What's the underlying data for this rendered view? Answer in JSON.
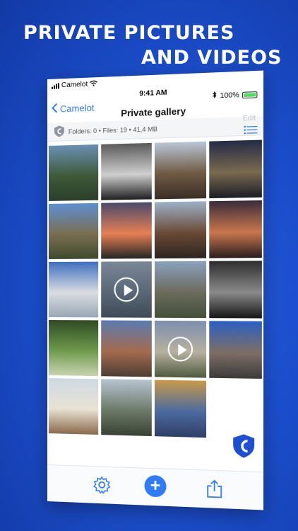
{
  "headline": {
    "line1": "PRIVATE PICTURES",
    "line2": "AND VIDEOS"
  },
  "status": {
    "carrier": "Camelot",
    "time": "9:41 AM",
    "battery": "100%"
  },
  "nav": {
    "back_label": "Camelot",
    "title": "Private gallery"
  },
  "info": {
    "summary": "Folders: 0 • Files: 19 • 41,4 MB",
    "edit_label": "Edit"
  },
  "photos": [
    {
      "kind": "image",
      "colors": [
        "#6b8fb3",
        "#3e5a3a",
        "#2b3f2a"
      ]
    },
    {
      "kind": "image",
      "colors": [
        "#5a5a5a",
        "#cfcfcf",
        "#1e1e1e"
      ]
    },
    {
      "kind": "image",
      "colors": [
        "#b9c6d6",
        "#6f5a44",
        "#3a2e25"
      ]
    },
    {
      "kind": "image",
      "colors": [
        "#232b46",
        "#7a6a4f",
        "#1b1d25"
      ]
    },
    {
      "kind": "image",
      "colors": [
        "#5d8fd0",
        "#7a6e52",
        "#3f4a2c"
      ]
    },
    {
      "kind": "image",
      "colors": [
        "#4a4a6a",
        "#e67f55",
        "#252525"
      ]
    },
    {
      "kind": "image",
      "colors": [
        "#9db0c8",
        "#6a4a35",
        "#2c2420"
      ]
    },
    {
      "kind": "image",
      "colors": [
        "#3a2c3a",
        "#c9774d",
        "#2a1e1e"
      ]
    },
    {
      "kind": "image",
      "colors": [
        "#3f6fbe",
        "#d9dde2",
        "#9aa7b4"
      ]
    },
    {
      "kind": "video",
      "colors": [
        "#7b8796",
        "#5a6776",
        "#3e4a57"
      ]
    },
    {
      "kind": "image",
      "colors": [
        "#8aa0bd",
        "#6c6b5d",
        "#43503a"
      ]
    },
    {
      "kind": "image",
      "colors": [
        "#2d2d2d",
        "#8a8a8a",
        "#151515"
      ]
    },
    {
      "kind": "image",
      "colors": [
        "#2f4a24",
        "#6f9a4c",
        "#c8d3b0"
      ]
    },
    {
      "kind": "image",
      "colors": [
        "#5b7bb0",
        "#a56a4f",
        "#4d3e33"
      ]
    },
    {
      "kind": "video",
      "colors": [
        "#7d8fae",
        "#b8b0a0",
        "#4e5b3e"
      ]
    },
    {
      "kind": "image",
      "colors": [
        "#2b5fc2",
        "#7d6f66",
        "#3c3a3a"
      ]
    },
    {
      "kind": "image",
      "colors": [
        "#cfd9e4",
        "#e8e2d3",
        "#8b6a4c"
      ]
    },
    {
      "kind": "image",
      "colors": [
        "#b7c3d0",
        "#6c7a6a",
        "#384232"
      ]
    },
    {
      "kind": "image",
      "colors": [
        "#c79a4a",
        "#4c6aa0",
        "#2f3f66"
      ]
    }
  ],
  "colors": {
    "accent": "#2f7cf6",
    "brand": "#1c4fcf"
  }
}
